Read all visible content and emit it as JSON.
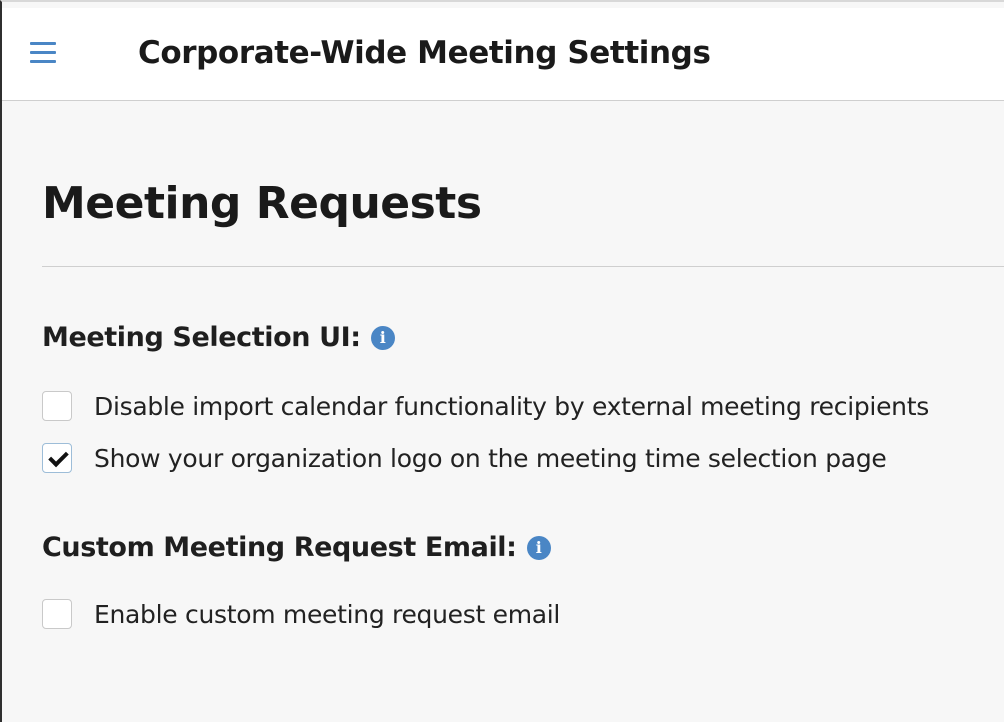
{
  "header": {
    "title": "Corporate-Wide Meeting Settings",
    "menu_icon": "hamburger-menu-icon"
  },
  "main": {
    "title": "Meeting Requests",
    "sections": [
      {
        "heading": "Meeting Selection UI:",
        "info_icon": "i",
        "options": [
          {
            "label": "Disable import calendar functionality by external meeting recipients",
            "checked": false
          },
          {
            "label": "Show your organization logo on the meeting time selection page",
            "checked": true
          }
        ]
      },
      {
        "heading": "Custom Meeting Request Email:",
        "info_icon": "i",
        "options": [
          {
            "label": "Enable custom meeting request email",
            "checked": false
          }
        ]
      }
    ]
  },
  "colors": {
    "accent": "#4a86c5",
    "background": "#f7f7f7",
    "header_background": "#ffffff"
  }
}
